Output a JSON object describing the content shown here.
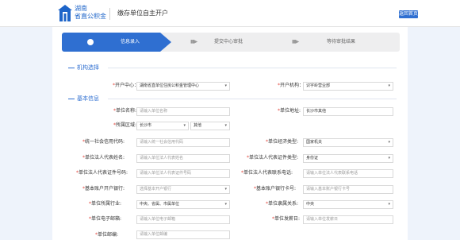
{
  "header": {
    "brand_line1": "湖南",
    "brand_line2": "省直公积金",
    "title": "缴存单位自主开户",
    "home_button": "返回首页"
  },
  "steps": [
    "信息录入",
    "提交中心审批",
    "等待审批结果"
  ],
  "sections": {
    "agency": "机构选择",
    "basic": "基本信息"
  },
  "agency": {
    "center_label": "开户中心：",
    "center_value": "湖南省直单位住房公积金管理中心",
    "org_label": "开户机构：",
    "org_value": "识字岭营业部"
  },
  "form": {
    "unit_name_label": "单位名称:",
    "unit_name_placeholder": "请输入单位名称",
    "unit_address_label": "单位地址:",
    "unit_address_value": "长沙市其他",
    "region_label": "所属区域:",
    "region_city": "长沙市",
    "region_district": "其他",
    "credit_code_label": "统一社会信用代码:",
    "credit_code_placeholder": "请输入统一社会信用代码",
    "econ_type_label": "单位经济类型:",
    "econ_type_value": "国家机关",
    "legal_name_label": "单位法人代表姓名:",
    "legal_name_placeholder": "请输入单位法人代表姓名",
    "legal_cert_type_label": "单位法人代表证件类型:",
    "legal_cert_type_value": "身份证",
    "legal_cert_no_label": "单位法人代表证件号码:",
    "legal_cert_no_placeholder": "请输入单位法人代表证件号码",
    "legal_phone_label": "单位法人代表联系电话:",
    "legal_phone_placeholder": "请输入单位法人代表联系电话",
    "bank_label": "基本账户开户银行:",
    "bank_placeholder": "选择基本开户银行",
    "bank_account_label": "基本账户银行卡号:",
    "bank_account_placeholder": "请输入基本账户银行卡号",
    "industry_label": "单位所属行业:",
    "industry_value": "中央、省属、市属单位",
    "affiliation_label": "单位隶属关系:",
    "affiliation_value": "中央",
    "email_label": "单位电子邮箱:",
    "email_placeholder": "请输入单位电子邮箱",
    "found_date_label": "单位发薪日:",
    "found_date_placeholder": "请输入单位发薪日",
    "postcode_label": "单位邮编:",
    "postcode_placeholder": "请输入单位邮编"
  },
  "colors": {
    "accent": "#2f6fd1",
    "background": "#eef3fb"
  }
}
